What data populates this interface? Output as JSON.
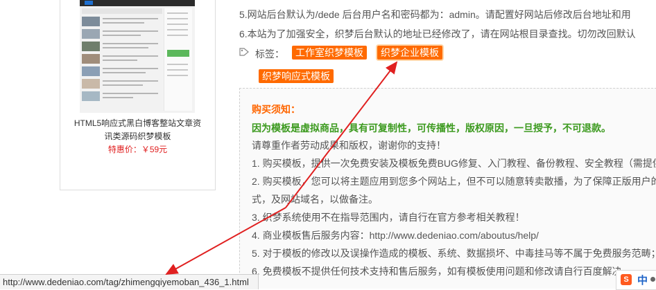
{
  "product": {
    "title_line1": "HTML5响应式黑白博客整站文章资",
    "title_line2": "讯类源码织梦模板",
    "price": "特惠价：￥59元"
  },
  "content": {
    "line5": "5.网站后台默认为/dede 后台用户名和密码都为：admin。请配置好网站后修改后台地址和用",
    "line6": "6.本站为了加强安全，织梦后台默认的地址已经修改了，请在网站根目录查找。切勿改回默认",
    "tags_label": "标签：",
    "tags": [
      "工作室织梦模板",
      "织梦企业模板",
      "织梦响应式模板"
    ]
  },
  "notice": {
    "title": "购买须知：",
    "warning": "因为模板是虚拟商品，具有可复制性，可传播性，版权原因，一旦授予，不可退款。",
    "respect": "请尊重作者劳动成果和版权，谢谢你的支持！",
    "item1": "1. 购买模板，提供一次免费安装及模板免费BUG修复、入门教程、备份教程、安全教程（需提供",
    "item2a": "2. 购买模板，您可以将主题应用到您多个网站上，但不可以随意转卖散播，为了保障正版用户的",
    "item2b": "式，及网站域名，以做备注。",
    "item3": "3. 织梦系统使用不在指导范围内，请自行在官方参考相关教程！",
    "item4": "4. 商业模板售后服务内容：http://www.dedeniao.com/aboutus/help/",
    "item5": "5. 对于模板的修改以及误操作造成的模板、系统、数据损坏、中毒挂马等不属于免费服务范畴；",
    "item6": "6. 免费模板不提供任何技术支持和售后服务，如有模板使用问题和修改请自行百度解决"
  },
  "status": {
    "url": "http://www.dedeniao.com/tag/zhimengqiyemoban_436_1.html"
  },
  "ime": {
    "lang": "中"
  },
  "colors": {
    "tag_bg": "#ff6a00",
    "notice_title": "#ff6600",
    "notice_warning": "#3c9a1f",
    "arrow": "#e02020",
    "price": "#e02020"
  }
}
